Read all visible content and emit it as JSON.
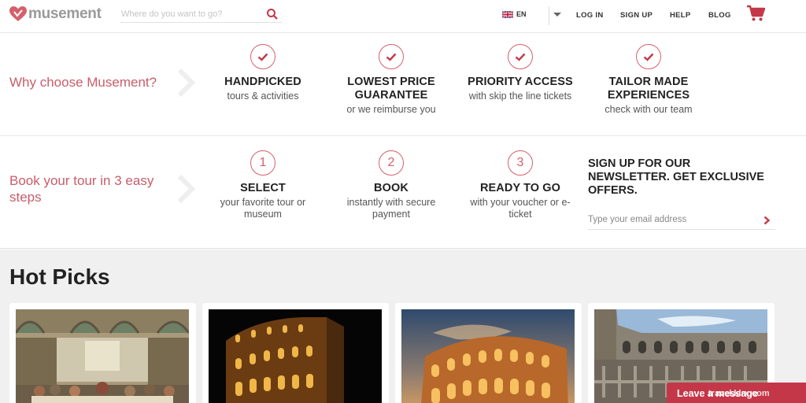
{
  "header": {
    "brand": "musement",
    "search_placeholder": "Where do you want to go?",
    "language": "EN",
    "nav": [
      "LOG IN",
      "SIGN UP",
      "HELP",
      "BLOG"
    ],
    "accent_color": "#d4606c"
  },
  "why": {
    "title": "Why choose Musement?",
    "features": [
      {
        "title": "HANDPICKED",
        "subtitle": "tours & activities",
        "icon": "check-icon"
      },
      {
        "title": "LOWEST PRICE GUARANTEE",
        "subtitle": "or we reimburse you",
        "icon": "check-icon"
      },
      {
        "title": "PRIORITY ACCESS",
        "subtitle": "with skip the line tickets",
        "icon": "check-icon"
      },
      {
        "title": "TAILOR MADE EXPERIENCES",
        "subtitle": "check with our team",
        "icon": "check-icon"
      }
    ]
  },
  "steps": {
    "title": "Book your tour in 3 easy steps",
    "items": [
      {
        "number": "1",
        "title": "SELECT",
        "subtitle": "your favorite tour or museum"
      },
      {
        "number": "2",
        "title": "BOOK",
        "subtitle": "instantly with secure payment"
      },
      {
        "number": "3",
        "title": "READY TO GO",
        "subtitle": "with your voucher or e-ticket"
      }
    ]
  },
  "newsletter": {
    "title": "SIGN UP FOR OUR NEWSLETTER. GET EXCLUSIVE OFFERS.",
    "placeholder": "Type your email address"
  },
  "hot_picks": {
    "title": "Hot Picks",
    "cards": [
      {
        "image": "last-supper-fresco"
      },
      {
        "image": "colosseum-night"
      },
      {
        "image": "colosseum-sunset"
      },
      {
        "image": "colosseum-interior"
      }
    ]
  },
  "chat": {
    "label": "Leave a message"
  },
  "watermark": "travel.klrx.com"
}
